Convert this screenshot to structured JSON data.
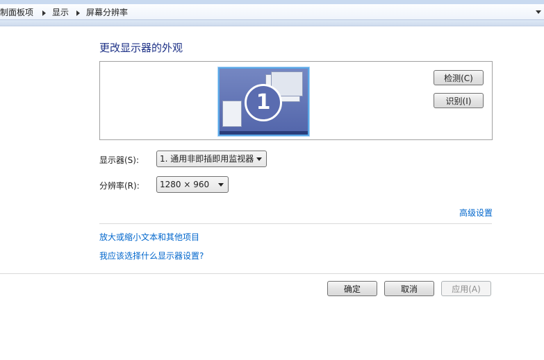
{
  "breadcrumb": {
    "items": [
      "控制面板项",
      "显示",
      "屏幕分辨率"
    ]
  },
  "main": {
    "title": "更改显示器的外观",
    "detect_button": "检测(C)",
    "identify_button": "识别(I)",
    "monitor_number": "1",
    "display_label": "显示器(S):",
    "display_value": "1. 通用非即插即用监视器",
    "resolution_label": "分辨率(R):",
    "resolution_value": "1280 × 960",
    "advanced_link": "高级设置",
    "links": [
      "放大或缩小文本和其他项目",
      "我应该选择什么显示器设置?"
    ]
  },
  "footer": {
    "ok": "确定",
    "cancel": "取消",
    "apply": "应用(A)"
  },
  "colors": {
    "title": "#1e3287",
    "link": "#0066cc",
    "monitor_border": "#59a7e6"
  }
}
